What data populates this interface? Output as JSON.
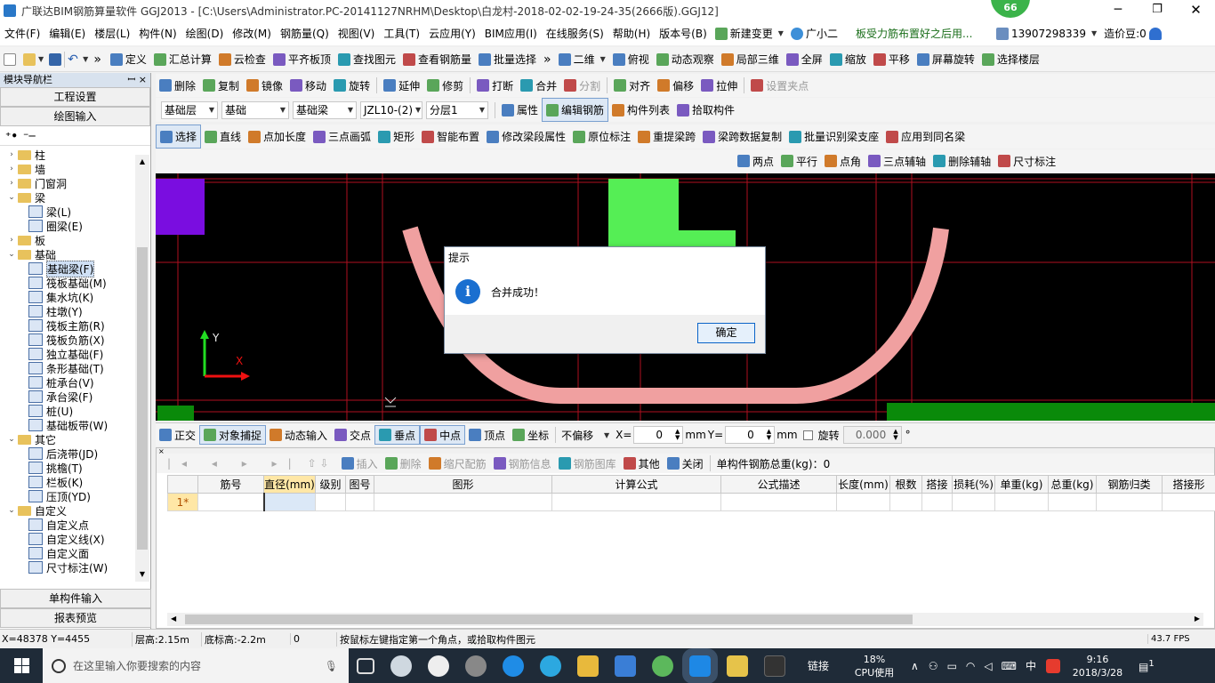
{
  "window": {
    "title": "广联达BIM钢筋算量软件 GGJ2013 - [C:\\Users\\Administrator.PC-20141127NRHM\\Desktop\\白龙村-2018-02-02-19-24-35(2666版).GGJ12]",
    "badge_count": "66"
  },
  "menu": {
    "items": [
      "文件(F)",
      "编辑(E)",
      "楼层(L)",
      "构件(N)",
      "绘图(D)",
      "修改(M)",
      "钢筋量(Q)",
      "视图(V)",
      "工具(T)",
      "云应用(Y)",
      "BIM应用(I)",
      "在线服务(S)",
      "帮助(H)",
      "版本号(B)"
    ],
    "new_change": "新建变更",
    "assistant": "广小二",
    "notice": "板受力筋布置好之后用...",
    "phone": "13907298339",
    "coins": "造价豆:0"
  },
  "toolbar1": [
    "定义",
    "汇总计算",
    "云检查",
    "平齐板顶",
    "查找图元",
    "查看钢筋量",
    "批量选择"
  ],
  "toolbar1_right": {
    "view_mode": "二维",
    "items": [
      "俯视",
      "动态观察",
      "局部三维",
      "全屏",
      "缩放",
      "平移",
      "屏幕旋转",
      "选择楼层"
    ]
  },
  "toolbar2": [
    "删除",
    "复制",
    "镜像",
    "移动",
    "旋转",
    "延伸",
    "修剪",
    "打断",
    "合并",
    "分割",
    "对齐",
    "偏移",
    "拉伸",
    "设置夹点"
  ],
  "toolbar3": {
    "floor": "基础层",
    "category": "基础",
    "type": "基础梁",
    "element": "JZL10-(2)",
    "layer": "分层1",
    "items": [
      "属性",
      "编辑钢筋",
      "构件列表",
      "拾取构件"
    ]
  },
  "toolbar4": [
    "选择",
    "直线",
    "点加长度",
    "三点画弧",
    "矩形",
    "智能布置",
    "修改梁段属性",
    "原位标注",
    "重提梁跨",
    "梁跨数据复制",
    "批量识别梁支座",
    "应用到同名梁"
  ],
  "toolbar5": [
    "两点",
    "平行",
    "点角",
    "三点辅轴",
    "删除辅轴",
    "尺寸标注"
  ],
  "nav": {
    "title": "模块导航栏",
    "pin": "ꟷ ×",
    "project_settings": "工程设置",
    "drawing_input": "绘图输入",
    "tree": [
      {
        "label": "柱",
        "level": 0,
        "expanded": false
      },
      {
        "label": "墙",
        "level": 0,
        "expanded": false
      },
      {
        "label": "门窗洞",
        "level": 0,
        "expanded": false
      },
      {
        "label": "梁",
        "level": 0,
        "expanded": true
      },
      {
        "label": "梁(L)",
        "level": 1
      },
      {
        "label": "圈梁(E)",
        "level": 1
      },
      {
        "label": "板",
        "level": 0,
        "expanded": false
      },
      {
        "label": "基础",
        "level": 0,
        "expanded": true
      },
      {
        "label": "基础梁(F)",
        "level": 1,
        "selected": true
      },
      {
        "label": "筏板基础(M)",
        "level": 1
      },
      {
        "label": "集水坑(K)",
        "level": 1
      },
      {
        "label": "柱墩(Y)",
        "level": 1
      },
      {
        "label": "筏板主筋(R)",
        "level": 1
      },
      {
        "label": "筏板负筋(X)",
        "level": 1
      },
      {
        "label": "独立基础(F)",
        "level": 1
      },
      {
        "label": "条形基础(T)",
        "level": 1
      },
      {
        "label": "桩承台(V)",
        "level": 1
      },
      {
        "label": "承台梁(F)",
        "level": 1
      },
      {
        "label": "桩(U)",
        "level": 1
      },
      {
        "label": "基础板带(W)",
        "level": 1
      },
      {
        "label": "其它",
        "level": 0,
        "expanded": true
      },
      {
        "label": "后浇带(JD)",
        "level": 1
      },
      {
        "label": "挑檐(T)",
        "level": 1
      },
      {
        "label": "栏板(K)",
        "level": 1
      },
      {
        "label": "压顶(YD)",
        "level": 1
      },
      {
        "label": "自定义",
        "level": 0,
        "expanded": true
      },
      {
        "label": "自定义点",
        "level": 1
      },
      {
        "label": "自定义线(X)",
        "level": 1
      },
      {
        "label": "自定义面",
        "level": 1
      },
      {
        "label": "尺寸标注(W)",
        "level": 1
      }
    ],
    "single_input": "单构件输入",
    "report_preview": "报表预览"
  },
  "canvas": {
    "axis_x": "X",
    "axis_y": "Y"
  },
  "dialog": {
    "title": "提示",
    "message": "合并成功！",
    "ok": "确定"
  },
  "snapbar": {
    "items": [
      "正交",
      "对象捕捉",
      "动态输入",
      "交点",
      "垂点",
      "中点",
      "顶点",
      "坐标"
    ],
    "offset": "不偏移",
    "x_label": "X=",
    "x_value": "0",
    "y_label": "Y=",
    "y_value": "0",
    "unit": "mm",
    "rotate_label": "旋转",
    "rotate_value": "0.000",
    "deg": "°"
  },
  "rebar_toolbar": {
    "items": [
      "插入",
      "删除",
      "缩尺配筋",
      "钢筋信息",
      "钢筋图库",
      "其他",
      "关闭"
    ],
    "total_label": "单构件钢筋总重(kg)：0"
  },
  "rebar_table": {
    "headers": [
      "筋号",
      "直径(mm)",
      "级别",
      "图号",
      "图形",
      "计算公式",
      "公式描述",
      "长度(mm)",
      "根数",
      "搭接",
      "损耗(%)",
      "单重(kg)",
      "总重(kg)",
      "钢筋归类",
      "搭接形"
    ],
    "row_marker": "1*"
  },
  "status": {
    "coords": "X=48378 Y=4455",
    "floor_height": "层高:2.15m",
    "bottom_elev": "底标高:-2.2m",
    "zero": "0",
    "hint": "按鼠标左键指定第一个角点，或拾取构件图元",
    "fps": "43.7 FPS"
  },
  "taskbar": {
    "search_placeholder": "在这里输入你要搜索的内容",
    "link_label": "链接",
    "cpu_percent": "18%",
    "cpu_label": "CPU使用",
    "ime": "中",
    "time": "9:16",
    "date": "2018/3/28",
    "notif": "1"
  }
}
